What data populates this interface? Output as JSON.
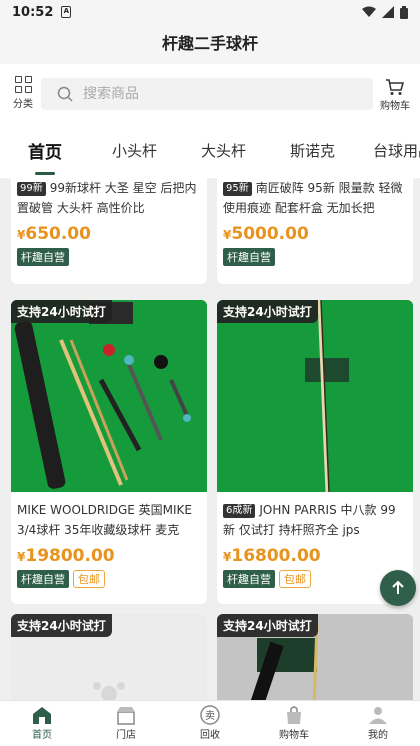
{
  "status": {
    "time": "10:52",
    "sim_label": "A"
  },
  "header": {
    "title": "杆趣二手球杆"
  },
  "search": {
    "category_label": "分类",
    "placeholder": "搜索商品",
    "cart_label": "购物车"
  },
  "tabs": [
    {
      "label": "首页",
      "active": true
    },
    {
      "label": "小头杆"
    },
    {
      "label": "大头杆"
    },
    {
      "label": "斯诺克"
    },
    {
      "label": "台球用品"
    }
  ],
  "products": [
    {
      "condition": "99新",
      "desc": "99新球杆 大圣 星空 后把内置破管 大头杆 高性价比",
      "price": "650.00",
      "tags": [
        "杆趣自营"
      ]
    },
    {
      "condition": "95新",
      "desc": "南匠破阵 95新 限量款 轻微使用痕迹 配套杆盒 无加长把",
      "price": "5000.00",
      "tags": [
        "杆趣自营"
      ]
    },
    {
      "trial": "支持24小时试打",
      "condition": "",
      "desc": "MIKE WOOLDRIDGE 英国MIKE 3/4球杆 35年收藏级球杆 麦克",
      "price": "19800.00",
      "tags": [
        "杆趣自营",
        "包邮"
      ]
    },
    {
      "trial": "支持24小时试打",
      "condition": "6成新",
      "desc": "JOHN PARRIS 中八款 99新 仅试打 持杆照齐全 jps",
      "price": "16800.00",
      "tags": [
        "杆趣自营",
        "包邮"
      ]
    },
    {
      "trial": "支持24小时试打"
    },
    {
      "trial": "支持24小时试打"
    }
  ],
  "currency": "¥",
  "bottom_nav": [
    {
      "label": "首页",
      "icon": "home-icon",
      "active": true
    },
    {
      "label": "门店",
      "icon": "store-icon"
    },
    {
      "label": "回收",
      "icon": "recycle-sell-icon",
      "badge_char": "卖"
    },
    {
      "label": "购物车",
      "icon": "cart-bag-icon"
    },
    {
      "label": "我的",
      "icon": "profile-icon"
    }
  ],
  "colors": {
    "brand": "#2f5e4a",
    "price": "#e8931e",
    "felt": "#159b3c"
  }
}
